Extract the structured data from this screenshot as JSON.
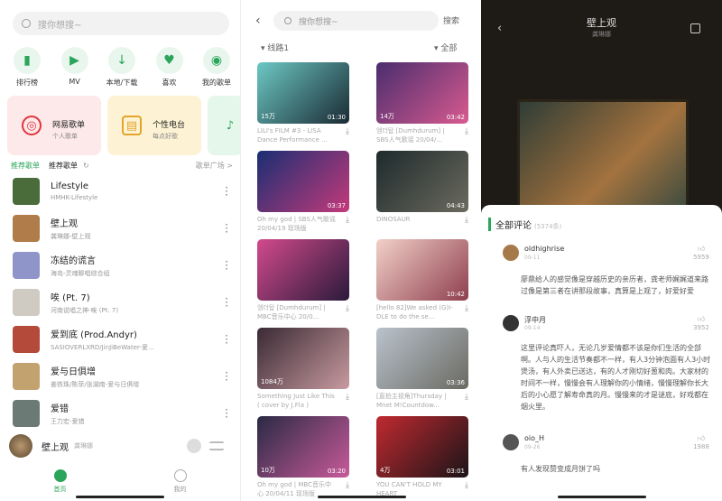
{
  "s1": {
    "search_placeholder": "搜你想搜~",
    "icons": [
      {
        "label": "排行榜",
        "icon": "chart-icon"
      },
      {
        "label": "MV",
        "icon": "video-icon"
      },
      {
        "label": "本地/下载",
        "icon": "download-icon"
      },
      {
        "label": "喜欢",
        "icon": "heart-icon"
      },
      {
        "label": "我的歌单",
        "icon": "disc-icon"
      }
    ],
    "cards": [
      {
        "title": "网易歌单",
        "sub": "个人歌单",
        "bg": "#fde9ea",
        "fg": "#e0343b"
      },
      {
        "title": "个性电台",
        "sub": "每点好歌",
        "bg": "#fdf3d4",
        "fg": "#e3a42a"
      },
      {
        "title": "",
        "sub": "",
        "bg": "#e5f6ea",
        "fg": "#2aa55a"
      }
    ],
    "tab_recommend": "推荐歌单",
    "tab_current": "推荐歌单",
    "more": "歌单广场 >",
    "songs": [
      {
        "title": "Lifestyle",
        "sub": "HMHK-Lifestyle",
        "color": "#4a6c3a"
      },
      {
        "title": "壁上观",
        "sub": "龚琳娜-壁上观",
        "color": "#b07c4a"
      },
      {
        "title": "冻结的谎言",
        "sub": "海岛-灵魂聊唱综合组",
        "color": "#8f95c8"
      },
      {
        "title": "唉 (Pt. 7)",
        "sub": "河南说唱之神-唉 (Pt. 7)",
        "color": "#cfcac2"
      },
      {
        "title": "爱到底 (Prod.Andyr)",
        "sub": "SASIOVERLXRD/JinJiBeWater-爱...",
        "color": "#b34a3a"
      },
      {
        "title": "爱与日俱增",
        "sub": "姜铁珠/陈菲/张湖南-爱与日俱增",
        "color": "#c2a26e"
      },
      {
        "title": "爱错",
        "sub": "王力宏-爱错",
        "color": "#6c7a76"
      }
    ],
    "player_title": "壁上观",
    "player_artist": "龚琳娜",
    "nav_home": "首页",
    "nav_me": "我的"
  },
  "s2": {
    "search_placeholder": "搜你想搜~",
    "search_btn": "搜索",
    "line": "线路1",
    "all": "全部",
    "videos": [
      {
        "views": "15万",
        "dur": "01:30",
        "title": "LILI's FILM #3 - LISA Dance Performance ...",
        "c1": "#6cc8c4",
        "c2": "#1a2a33"
      },
      {
        "views": "14万",
        "dur": "03:42",
        "title": "엠더탑 [Dumhdurum] | SBS人气歌谣 20/04/...",
        "c1": "#4a2d6e",
        "c2": "#d85a8f"
      },
      {
        "views": "",
        "dur": "03:37",
        "title": "Oh my god | SBS人气歌谣 20/04/19 现场版",
        "c1": "#1a2e73",
        "c2": "#c43a7a"
      },
      {
        "views": "",
        "dur": "04:43",
        "title": "DINOSAUR",
        "c1": "#1d2a2c",
        "c2": "#6c6a5e"
      },
      {
        "views": "",
        "dur": "",
        "title": "엠더탑 [Dumhdurum] | MBC音乐中心 20/0...",
        "c1": "#d24a8d",
        "c2": "#2a1a3a"
      },
      {
        "views": "",
        "dur": "10:42",
        "title": "[hello 82]We asked (G)I-DLE to do the se...",
        "c1": "#f2d0c8",
        "c2": "#8e3f4e"
      },
      {
        "views": "1084万",
        "dur": "",
        "title": "Something Just Like This ( cover by J.Fla )",
        "c1": "#3a2a34",
        "c2": "#c89aa0"
      },
      {
        "views": "",
        "dur": "03:36",
        "title": "[直拍主视角]Thursday | Mnet M!Countdow...",
        "c1": "#b9c2cc",
        "c2": "#6a6a62"
      },
      {
        "views": "10万",
        "dur": "03:20",
        "title": "Oh my god | MBC音乐中心 20/04/11 现场版",
        "c1": "#2a2a44",
        "c2": "#c85a9a"
      },
      {
        "views": "4万",
        "dur": "03:01",
        "title": "YOU CAN'T HOLD MY HEART",
        "c1": "#c02a30",
        "c2": "#1a1418"
      }
    ]
  },
  "s3": {
    "title": "壁上观",
    "artist": "龚琳娜",
    "comments_title": "全部评论",
    "comments_count": "(5374条)",
    "comments": [
      {
        "user": "oldhighrise",
        "date": "09-11",
        "likes": "5959",
        "text": "廖鼎给人的感觉像是穿越历史的亲历者，龚老师娓娓道来路过像是第三者在讲那段故事，真算是上观了，好爱好爱",
        "color": "#a6794a"
      },
      {
        "user": "浮中月",
        "date": "09-14",
        "likes": "3952",
        "text": "这里评论真吓人，无论几岁爱情都不该是你们生活的全部啊。人与人的生活节奏都不一样，有人3分钟泡面有人3小时煲汤，有人外卖已送达，有的人才刚切好葱和肉。大家材的时间不一样，慢慢会有人理解你的小情绪，慢慢理解你长大后的小心愿了解寿命真的月。慢慢来的才是谜底，好戏都在烟火里。",
        "color": "#333"
      },
      {
        "user": "oio_H",
        "date": "09-26",
        "likes": "1988",
        "text": "有人发现赞变成月饼了吗",
        "color": "#555"
      }
    ]
  }
}
